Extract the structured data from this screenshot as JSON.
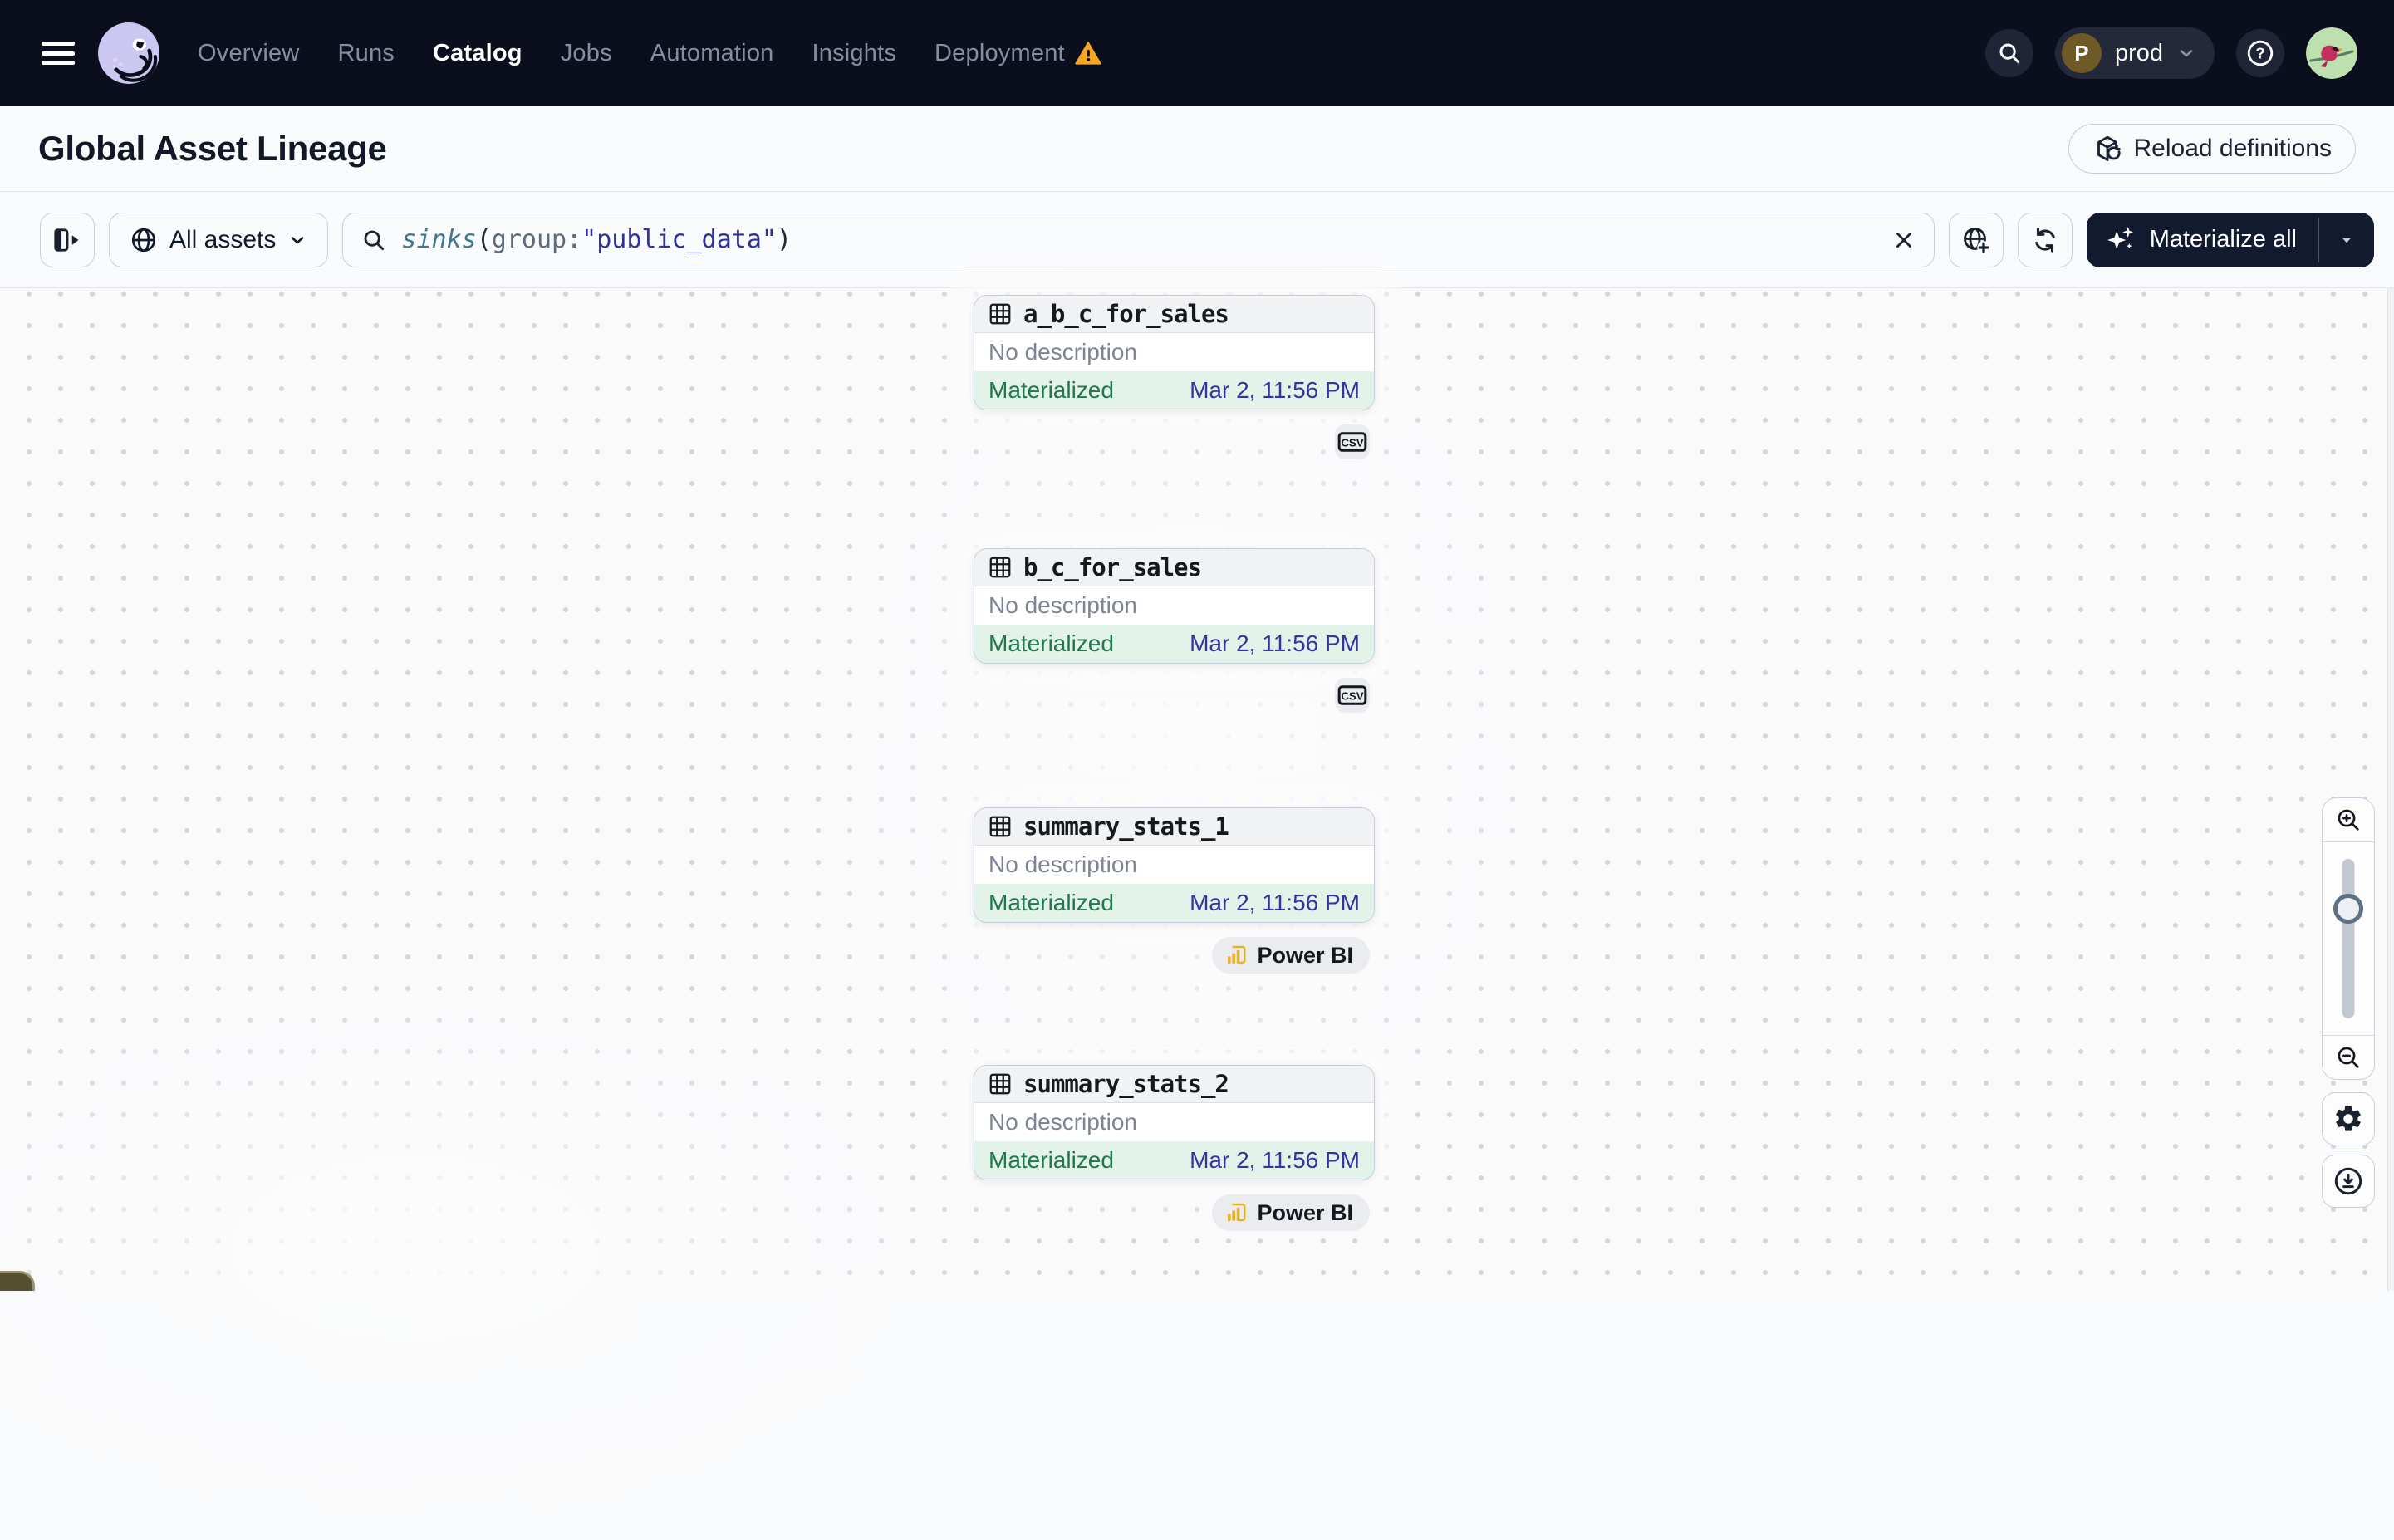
{
  "topnav": {
    "items": [
      {
        "label": "Overview"
      },
      {
        "label": "Runs"
      },
      {
        "label": "Catalog",
        "active": true
      },
      {
        "label": "Jobs"
      },
      {
        "label": "Automation"
      },
      {
        "label": "Insights"
      },
      {
        "label": "Deployment",
        "warning": true
      }
    ],
    "environment": {
      "initial": "P",
      "name": "prod"
    }
  },
  "header": {
    "title": "Global Asset Lineage",
    "reload_label": "Reload definitions"
  },
  "toolbar": {
    "filter_label": "All assets",
    "materialize_label": "Materialize all",
    "query": {
      "fn": "sinks",
      "open": "(",
      "key": "group",
      "colon": ":",
      "value": "\"public_data\"",
      "close": ")"
    }
  },
  "graph": {
    "assets": [
      {
        "name": "a_b_c_for_sales",
        "description": "No description",
        "status": "Materialized",
        "timestamp": "Mar 2, 11:56 PM",
        "tag": "CSV"
      },
      {
        "name": "b_c_for_sales",
        "description": "No description",
        "status": "Materialized",
        "timestamp": "Mar 2, 11:56 PM",
        "tag": "CSV"
      },
      {
        "name": "summary_stats_1",
        "description": "No description",
        "status": "Materialized",
        "timestamp": "Mar 2, 11:56 PM",
        "tag": "Power BI"
      },
      {
        "name": "summary_stats_2",
        "description": "No description",
        "status": "Materialized",
        "timestamp": "Mar 2, 11:56 PM",
        "tag": "Power BI"
      }
    ]
  },
  "icons": {
    "nav": [
      "hamburger-icon",
      "dagster-logo",
      "warning-icon",
      "search-icon",
      "chevron-down-icon",
      "help-icon"
    ],
    "toolbar": [
      "panel-toggle-icon",
      "globe-icon",
      "search-icon",
      "clear-x-icon",
      "globe-add-icon",
      "refresh-icon",
      "sparkles-icon",
      "caret-down-icon"
    ],
    "graph": [
      "table-icon",
      "csv-file-icon",
      "powerbi-icon",
      "zoom-in-icon",
      "zoom-out-icon",
      "gear-icon",
      "download-icon"
    ]
  },
  "colors": {
    "nav_background": "#0B0E1D",
    "status_green_text": "#20784E",
    "status_green_bg": "#E3F3E9",
    "timestamp_blue": "#3334A0",
    "warning_amber": "#F5A623",
    "powerbi_yellow": "#E8B320",
    "dark_button": "#121A30",
    "logo_lavender": "#CCC7F0"
  }
}
